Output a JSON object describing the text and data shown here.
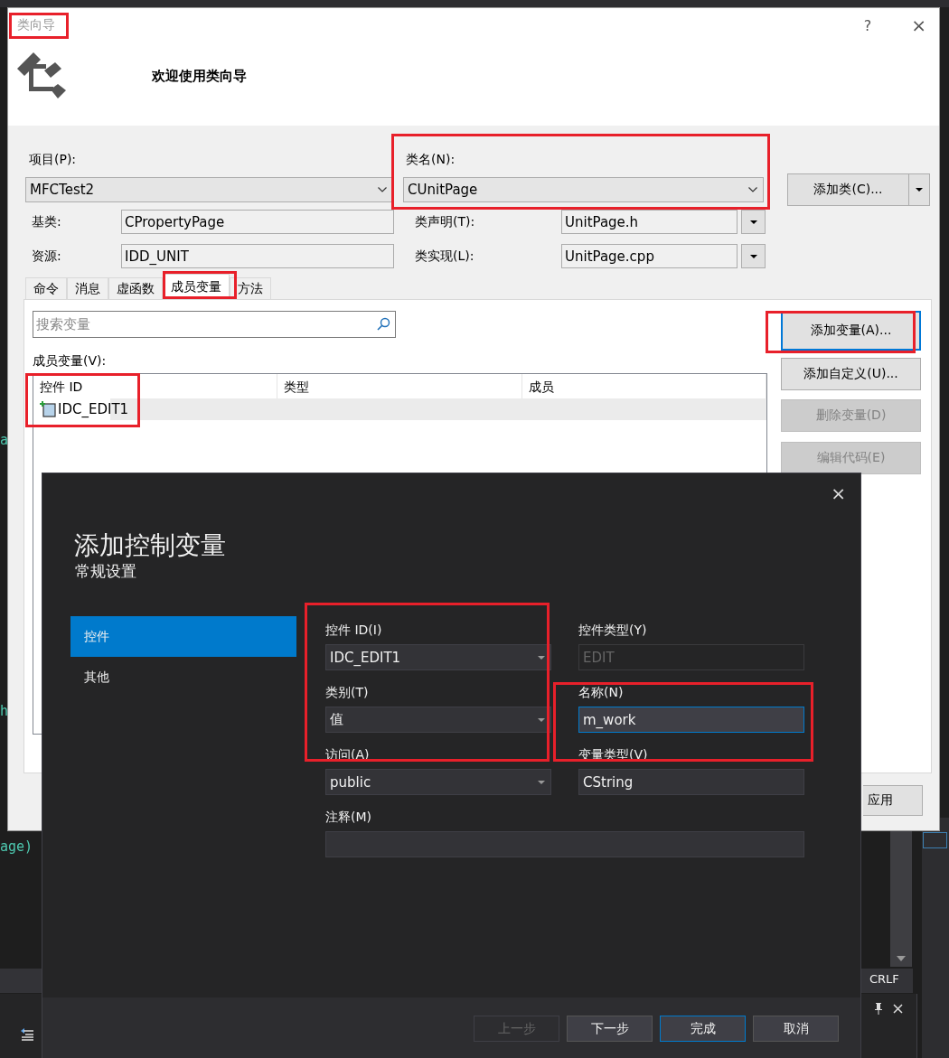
{
  "background_editor": {
    "code_fragments": [
      {
        "text": "a"
      },
      {
        "text": "h"
      },
      {
        "text": "age)"
      }
    ],
    "line_ending": "CRLF"
  },
  "class_wizard": {
    "title": "类向导",
    "help": "?",
    "close": "×",
    "heading": "欢迎使用类向导",
    "project": {
      "label": "项目(P):",
      "value": "MFCTest2"
    },
    "class_name": {
      "label": "类名(N):",
      "value": "CUnitPage"
    },
    "add_class_button": "添加类(C)...",
    "base_class": {
      "label": "基类:",
      "value": "CPropertyPage"
    },
    "class_declaration": {
      "label": "类声明(T):",
      "value": "UnitPage.h"
    },
    "resource": {
      "label": "资源:",
      "value": "IDD_UNIT"
    },
    "class_implementation": {
      "label": "类实现(L):",
      "value": "UnitPage.cpp"
    },
    "tabs": [
      {
        "label": "命令",
        "selected": false
      },
      {
        "label": "消息",
        "selected": false
      },
      {
        "label": "虚函数",
        "selected": false
      },
      {
        "label": "成员变量",
        "selected": true
      },
      {
        "label": "方法",
        "selected": false
      }
    ],
    "search": {
      "placeholder": "搜索变量"
    },
    "list_label": "成员变量(V):",
    "table": {
      "columns": [
        "控件 ID",
        "类型",
        "成员"
      ],
      "rows": [
        {
          "control_id": "IDC_EDIT1",
          "selected": true
        }
      ]
    },
    "side_buttons": [
      {
        "label": "添加变量(A)...",
        "default": true,
        "disabled": false
      },
      {
        "label": "添加自定义(U)...",
        "default": false,
        "disabled": false
      },
      {
        "label": "删除变量(D)",
        "default": false,
        "disabled": true
      },
      {
        "label": "编辑代码(E)",
        "default": false,
        "disabled": true
      }
    ],
    "apply_button": "应用"
  },
  "add_variable_dialog": {
    "title": "添加控制变量",
    "subtitle": "常规设置",
    "close": "×",
    "nav": [
      {
        "label": "控件",
        "selected": true
      },
      {
        "label": "其他",
        "selected": false
      }
    ],
    "fields": [
      {
        "label": "控件 ID(I)",
        "value": "IDC_EDIT1",
        "kind": "dropdown",
        "disabled": false,
        "focused": false
      },
      {
        "label": "控件类型(Y)",
        "value": "EDIT",
        "kind": "text",
        "disabled": true,
        "focused": false
      },
      {
        "label": "类别(T)",
        "value": "值",
        "kind": "dropdown",
        "disabled": false,
        "focused": false
      },
      {
        "label": "名称(N)",
        "value": "m_work",
        "kind": "text",
        "disabled": false,
        "focused": true
      },
      {
        "label": "访问(A)",
        "value": "public",
        "kind": "dropdown",
        "disabled": false,
        "focused": false
      },
      {
        "label": "变量类型(V)",
        "value": "CString",
        "kind": "text",
        "disabled": false,
        "focused": false
      },
      {
        "label": "注释(M)",
        "kind": "text",
        "disabled": false,
        "focused": false
      }
    ],
    "buttons": [
      {
        "label": "上一步",
        "disabled": true,
        "default": false
      },
      {
        "label": "下一步",
        "disabled": false,
        "default": false
      },
      {
        "label": "完成",
        "disabled": false,
        "default": true
      },
      {
        "label": "取消",
        "disabled": false,
        "default": false
      }
    ]
  }
}
